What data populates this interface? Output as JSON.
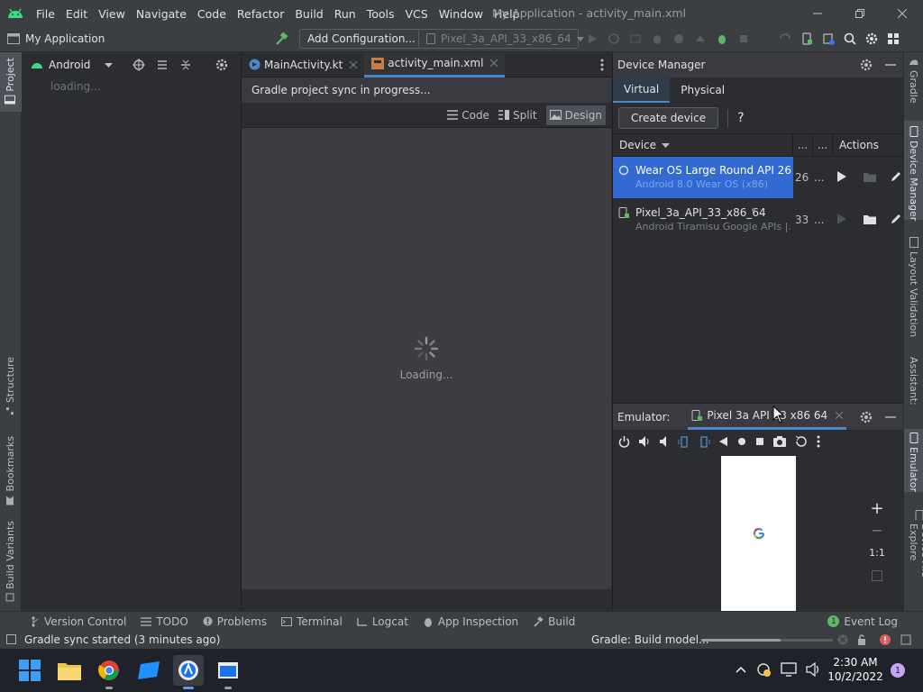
{
  "menu": [
    "File",
    "Edit",
    "View",
    "Navigate",
    "Code",
    "Refactor",
    "Build",
    "Run",
    "Tools",
    "VCS",
    "Window",
    "Help"
  ],
  "window_title": "My Application - activity_main.xml",
  "toolbar": {
    "project_name": "My Application",
    "add_config": "Add Configuration...",
    "device_select": "Pixel_3a_API_33_x86_64"
  },
  "left_stripe": {
    "project": "Project",
    "structure": "Structure",
    "bookmarks": "Bookmarks",
    "build_variants": "Build Variants"
  },
  "right_stripe": {
    "gradle": "Gradle",
    "device_manager": "Device Manager",
    "layout_validation": "Layout Validation",
    "assistant": "Assistant:",
    "emulator": "Emulator",
    "device_file_explorer": "Device File Explore"
  },
  "project_panel": {
    "view": "Android",
    "loading": "loading..."
  },
  "editor": {
    "tabs": [
      {
        "label": "MainActivity.kt"
      },
      {
        "label": "activity_main.xml"
      }
    ],
    "sync_message": "Gradle project sync in progress...",
    "modes": {
      "code": "Code",
      "split": "Split",
      "design": "Design"
    },
    "loading": "Loading..."
  },
  "device_manager": {
    "title": "Device Manager",
    "tabs": {
      "virtual": "Virtual",
      "physical": "Physical"
    },
    "create_device": "Create device",
    "help": "?",
    "columns": {
      "device": "Device",
      "c2": "...",
      "c3": "...",
      "actions": "Actions"
    },
    "devices": [
      {
        "name": "Wear OS Large Round API 26",
        "sub": "Android 8.0 Wear OS (x86)",
        "api": "26",
        "more": "..."
      },
      {
        "name": "Pixel_3a_API_33_x86_64",
        "sub": "Android Tiramisu Google APIs |...",
        "api": "33",
        "more": "..."
      }
    ]
  },
  "emulator": {
    "label": "Emulator:",
    "tab": "Pixel 3a API 33 x86 64",
    "zoom_ratio": "1:1"
  },
  "bottom_tools": [
    "Version Control",
    "TODO",
    "Problems",
    "Terminal",
    "Logcat",
    "App Inspection",
    "Build"
  ],
  "event_log": {
    "label": "Event Log",
    "count": "1"
  },
  "status": {
    "left": "Gradle sync started (3 minutes ago)",
    "right": "Gradle: Build model..."
  },
  "taskbar": {
    "time": "2:30 AM",
    "date": "10/2/2022",
    "notif": "1"
  },
  "colors": {
    "accent": "#4a88c7",
    "selected_row": "#3574f0",
    "green": "#5fb865"
  }
}
